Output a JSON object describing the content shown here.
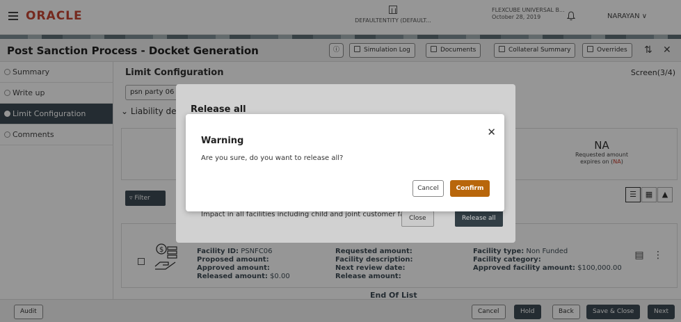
{
  "header": {
    "logo": "ORACLE",
    "entity": "DEFAULTENTITY (DEFAULT...",
    "product": "FLEXCUBE UNIVERSAL B...",
    "date": "October 28, 2019",
    "user": "NARAYAN"
  },
  "titlebar": {
    "title": "Post Sanction Process - Docket Generation",
    "simulation_log": "Simulation Log",
    "documents": "Documents",
    "collateral_summary": "Collateral Summary",
    "overrides": "Overrides"
  },
  "sidebar": {
    "items": [
      {
        "label": "Summary"
      },
      {
        "label": "Write up"
      },
      {
        "label": "Limit Configuration"
      },
      {
        "label": "Comments"
      }
    ]
  },
  "main": {
    "section_title": "Limit Configuration",
    "screen": "Screen(3/4)",
    "party": "psn party 06",
    "liability": "Liability de",
    "na_value": "NA",
    "na_label": "Requested amount",
    "na_label2": "expires on (",
    "na_red": "NA",
    "na_close": ")",
    "filter": "Filter",
    "facility": {
      "id_label": "Facility ID:",
      "id_value": "PSNFC06",
      "proposed": "Proposed amount:",
      "approved": "Approved amount:",
      "released_label": "Released amount:",
      "released_value": "$0.00",
      "requested": "Requested amount:",
      "description": "Facility description:",
      "next_review": "Next review date:",
      "release_amount": "Release amount:",
      "type_label": "Facility type:",
      "type_value": "Non Funded",
      "category": "Facility category:",
      "approved_facility_label": "Approved facility amount:",
      "approved_facility_value": "$100,000.00"
    },
    "end_of_list": "End Of List"
  },
  "footer": {
    "audit": "Audit",
    "cancel": "Cancel",
    "hold": "Hold",
    "back": "Back",
    "save_close": "Save & Close",
    "next": "Next"
  },
  "release_modal": {
    "title": "Release all",
    "impact": "Impact in all facilities including child and joint customer facilities",
    "close": "Close",
    "release_all": "Release all"
  },
  "warning_modal": {
    "title": "Warning",
    "message": "Are you sure, do you want to release all?",
    "cancel": "Cancel",
    "confirm": "Confirm"
  },
  "colors": {
    "brand": "#c74634",
    "dark": "#3e4c55",
    "confirm": "#b8660b"
  }
}
